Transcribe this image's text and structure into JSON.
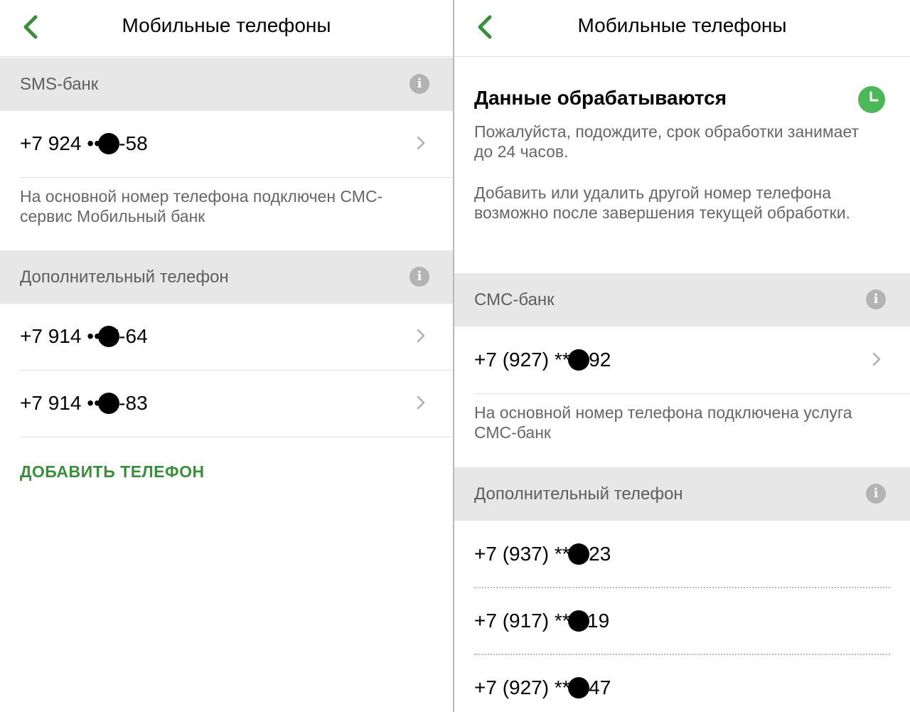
{
  "left": {
    "title": "Мобильные телефоны",
    "sms_section": "SMS-банк",
    "primary_phone": {
      "prefix": "+7 924 •••",
      "suffix": "9-58"
    },
    "note": "На основной номер телефона подключен СМС-сервис Мобильный банк",
    "additional_section": "Дополнительный телефон",
    "additional_phones": [
      {
        "prefix": "+7 914 •••",
        "suffix": "7-64"
      },
      {
        "prefix": "+7 914 •••",
        "suffix": "3-83"
      }
    ],
    "add_button": "ДОБАВИТЬ ТЕЛЕФОН"
  },
  "right": {
    "title": "Мобильные телефоны",
    "processing": {
      "title": "Данные обрабатываются",
      "text1": "Пожалуйста, подождите, срок обработки занимает до 24 часов.",
      "text2": "Добавить или удалить другой номер телефона возможно после завершения текущей обработки."
    },
    "sms_section": "СМС-банк",
    "primary_phone": {
      "prefix": "+7 (927) ***",
      "suffix": "692"
    },
    "note": "На основной номер телефона подключена услуга СМС-банк",
    "additional_section": "Дополнительный телефон",
    "additional_phones": [
      {
        "prefix": "+7 (937) ***",
        "suffix": "223"
      },
      {
        "prefix": "+7 (917) ***",
        "suffix": "119"
      },
      {
        "prefix": "+7 (927) ***",
        "suffix": "347"
      }
    ]
  },
  "icons": {
    "back": "chevron-left-icon",
    "info": "info-icon",
    "chevron": "chevron-right-icon",
    "clock": "clock-icon",
    "info_glyph": "i"
  },
  "colors": {
    "accent_green": "#3b8e3e",
    "clock_green": "#4cb85a",
    "section_bg": "#e7e7e7",
    "secondary_text": "#666666"
  }
}
